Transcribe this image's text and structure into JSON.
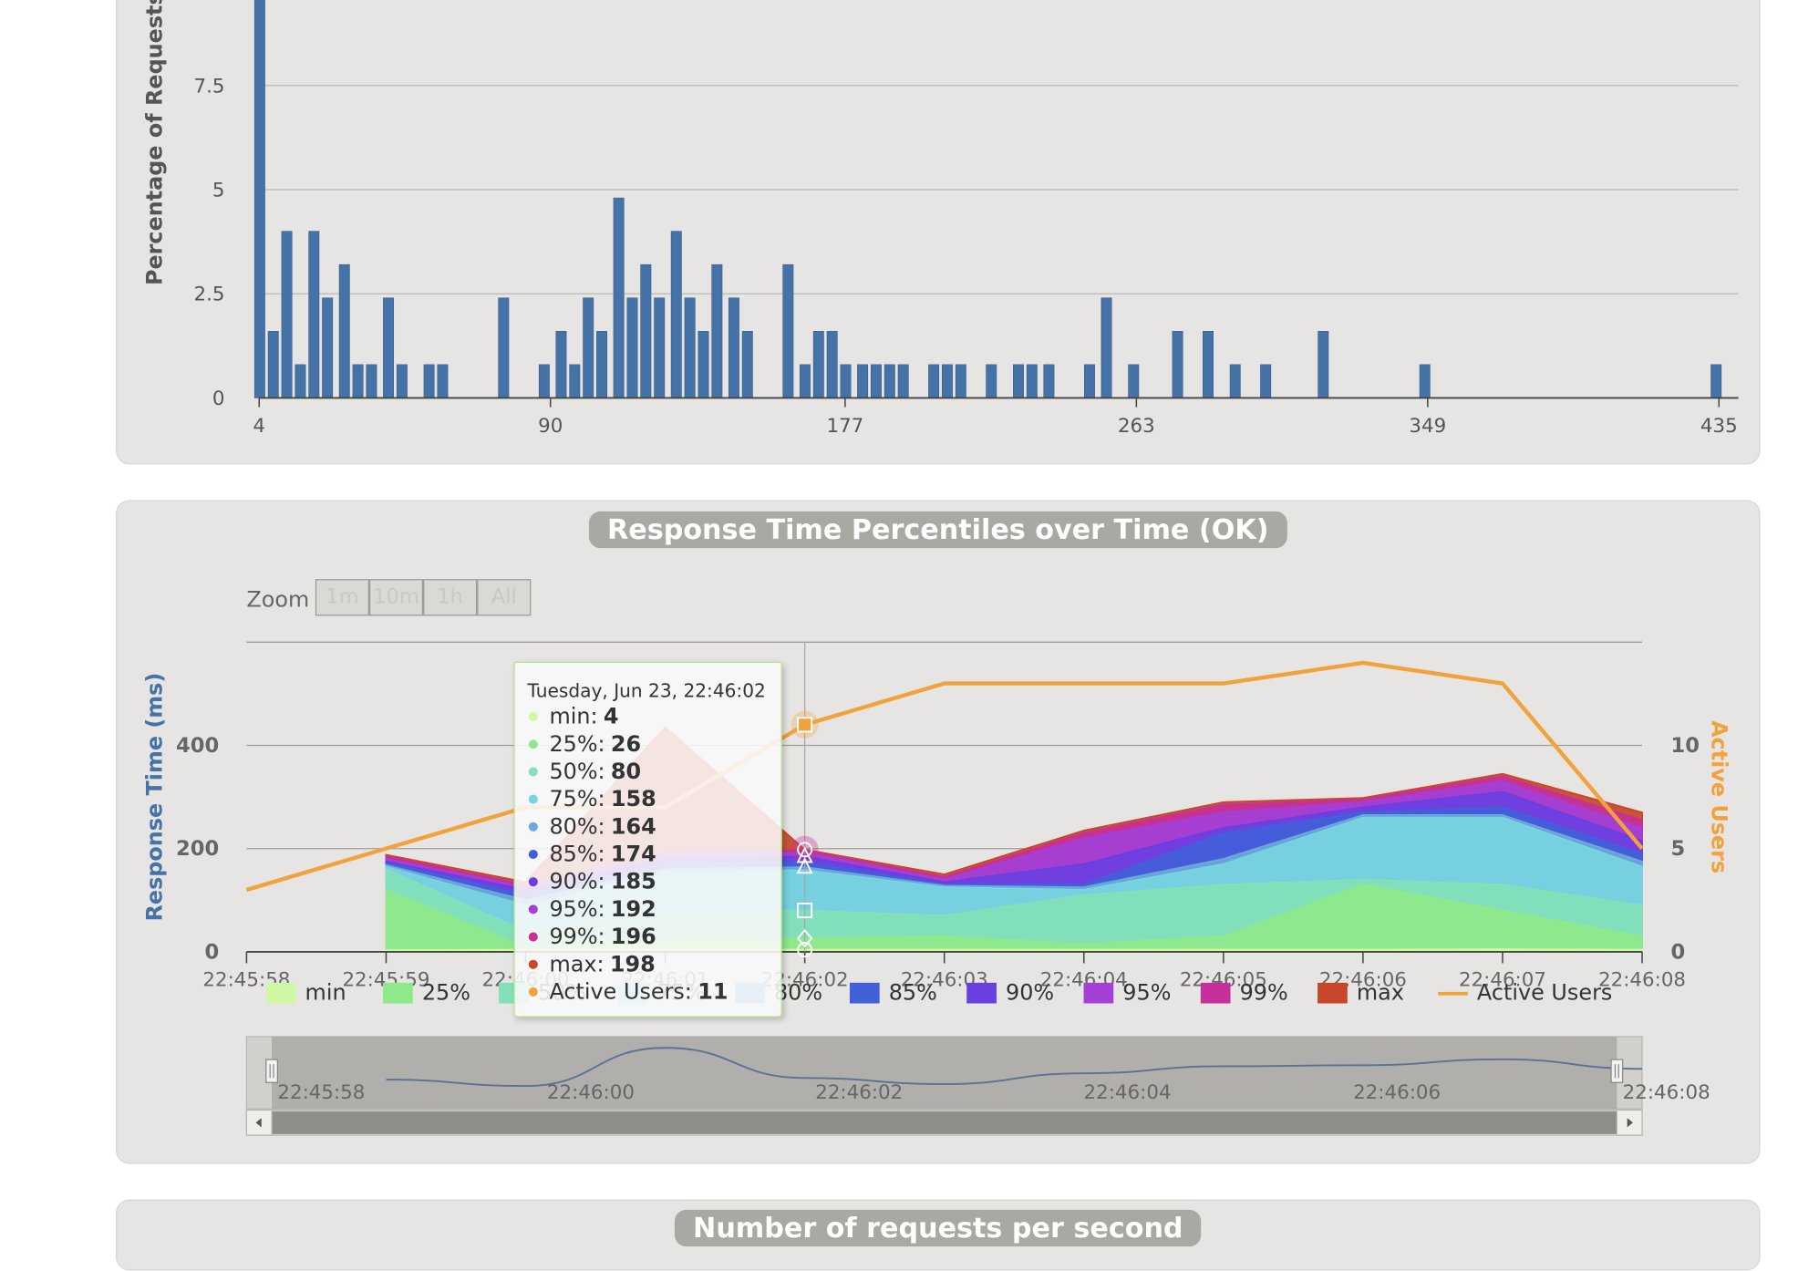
{
  "distribution": {
    "ylabel": "Percentage of Requests",
    "yticks": [
      "0",
      "2.5",
      "5",
      "7.5"
    ],
    "xticks": [
      "4",
      "90",
      "177",
      "263",
      "349",
      "435"
    ]
  },
  "percentiles": {
    "title": "Response Time Percentiles over Time (OK)",
    "zoom_label": "Zoom",
    "zoom_buttons": [
      "1m",
      "10m",
      "1h",
      "All"
    ],
    "left_axis_label": "Response Time (ms)",
    "right_axis_label": "Active Users",
    "left_ticks": [
      "0",
      "200",
      "400"
    ],
    "right_ticks": [
      "0",
      "5",
      "10"
    ],
    "x_ticks": [
      "22:45:58",
      "22:45:59",
      "22:46:00",
      "22:46:01",
      "22:46:02",
      "22:46:03",
      "22:46:04",
      "22:46:05",
      "22:46:06",
      "22:46:07",
      "22:46:08"
    ],
    "legend": [
      "min",
      "25%",
      "50%",
      "75%",
      "80%",
      "85%",
      "90%",
      "95%",
      "99%",
      "max",
      "Active Users"
    ],
    "navigator_labels": [
      "22:45:58",
      "22:46:00",
      "22:46:02",
      "22:46:04",
      "22:46:06",
      "22:46:08"
    ],
    "tooltip": {
      "header": "Tuesday, Jun 23, 22:46:02",
      "rows": [
        {
          "label": "min:",
          "value": "4"
        },
        {
          "label": "25%:",
          "value": "26"
        },
        {
          "label": "50%:",
          "value": "80"
        },
        {
          "label": "75%:",
          "value": "158"
        },
        {
          "label": "80%:",
          "value": "164"
        },
        {
          "label": "85%:",
          "value": "174"
        },
        {
          "label": "90%:",
          "value": "185"
        },
        {
          "label": "95%:",
          "value": "192"
        },
        {
          "label": "99%:",
          "value": "196"
        },
        {
          "label": "max:",
          "value": "198"
        },
        {
          "label": "Active Users:",
          "value": "11"
        }
      ]
    }
  },
  "next_panel": {
    "title": "Number of requests per second"
  },
  "colors": {
    "min": "#d0f7a3",
    "p25": "#8fe98a",
    "p50": "#83e0b8",
    "p75": "#77d4e0",
    "p80": "#6ca8d9",
    "p85": "#4160d9",
    "p90": "#6a3fe0",
    "p95": "#a43fd8",
    "p99": "#c5309a",
    "max": "#c8472a",
    "active_users": "#f0a23c",
    "axis_blue": "#4572a7"
  },
  "chart_data": [
    {
      "type": "bar",
      "ylabel": "Percentage of Requests",
      "ylim": [
        0,
        9.8
      ],
      "xlim": [
        4,
        435
      ],
      "grid": true,
      "bars": [
        [
          4,
          9.8
        ],
        [
          8,
          1.6
        ],
        [
          12,
          4.0
        ],
        [
          16,
          0.8
        ],
        [
          20,
          4.0
        ],
        [
          24,
          2.4
        ],
        [
          29,
          3.2
        ],
        [
          33,
          0.8
        ],
        [
          37,
          0.8
        ],
        [
          42,
          2.4
        ],
        [
          46,
          0.8
        ],
        [
          54,
          0.8
        ],
        [
          58,
          0.8
        ],
        [
          76,
          2.4
        ],
        [
          88,
          0.8
        ],
        [
          93,
          1.6
        ],
        [
          97,
          0.8
        ],
        [
          101,
          2.4
        ],
        [
          105,
          1.6
        ],
        [
          110,
          4.8
        ],
        [
          114,
          2.4
        ],
        [
          118,
          3.2
        ],
        [
          122,
          2.4
        ],
        [
          127,
          4.0
        ],
        [
          131,
          2.4
        ],
        [
          135,
          1.6
        ],
        [
          139,
          3.2
        ],
        [
          144,
          2.4
        ],
        [
          148,
          1.6
        ],
        [
          160,
          3.2
        ],
        [
          165,
          0.8
        ],
        [
          169,
          1.6
        ],
        [
          173,
          1.6
        ],
        [
          177,
          0.8
        ],
        [
          182,
          0.8
        ],
        [
          186,
          0.8
        ],
        [
          190,
          0.8
        ],
        [
          194,
          0.8
        ],
        [
          203,
          0.8
        ],
        [
          207,
          0.8
        ],
        [
          211,
          0.8
        ],
        [
          220,
          0.8
        ],
        [
          228,
          0.8
        ],
        [
          232,
          0.8
        ],
        [
          237,
          0.8
        ],
        [
          249,
          0.8
        ],
        [
          254,
          2.4
        ],
        [
          262,
          0.8
        ],
        [
          275,
          1.6
        ],
        [
          284,
          1.6
        ],
        [
          292,
          0.8
        ],
        [
          301,
          0.8
        ],
        [
          318,
          1.6
        ],
        [
          348,
          0.8
        ],
        [
          434,
          0.8
        ]
      ]
    },
    {
      "type": "area",
      "title": "Response Time Percentiles over Time (OK)",
      "x": [
        "22:45:58",
        "22:45:59",
        "22:46:00",
        "22:46:01",
        "22:46:02",
        "22:46:03",
        "22:46:04",
        "22:46:05",
        "22:46:06",
        "22:46:07",
        "22:46:08"
      ],
      "x_seconds": [
        0,
        1,
        2,
        3,
        4,
        5,
        6,
        7,
        8,
        9,
        10
      ],
      "left_ylim": [
        0,
        600
      ],
      "right_ylim": [
        0,
        15
      ],
      "series": [
        {
          "name": "min",
          "x": [
            1,
            2,
            3,
            4,
            5,
            6,
            7,
            8,
            9,
            10
          ],
          "values": [
            3,
            4,
            5,
            4,
            4,
            4,
            4,
            4,
            5,
            4
          ]
        },
        {
          "name": "25%",
          "x": [
            1,
            2,
            3,
            4,
            5,
            6,
            7,
            8,
            9,
            10
          ],
          "values": [
            120,
            10,
            26,
            26,
            30,
            15,
            30,
            130,
            80,
            30
          ]
        },
        {
          "name": "50%",
          "x": [
            1,
            2,
            3,
            4,
            5,
            6,
            7,
            8,
            9,
            10
          ],
          "values": [
            160,
            40,
            80,
            80,
            70,
            110,
            130,
            140,
            130,
            90
          ]
        },
        {
          "name": "75%",
          "x": [
            1,
            2,
            3,
            4,
            5,
            6,
            7,
            8,
            9,
            10
          ],
          "values": [
            165,
            90,
            155,
            158,
            125,
            120,
            170,
            260,
            260,
            165
          ]
        },
        {
          "name": "80%",
          "x": [
            1,
            2,
            3,
            4,
            5,
            6,
            7,
            8,
            9,
            10
          ],
          "values": [
            168,
            100,
            160,
            164,
            128,
            125,
            180,
            265,
            265,
            175
          ]
        },
        {
          "name": "85%",
          "x": [
            1,
            2,
            3,
            4,
            5,
            6,
            7,
            8,
            9,
            10
          ],
          "values": [
            172,
            110,
            170,
            174,
            130,
            130,
            230,
            270,
            280,
            190
          ]
        },
        {
          "name": "90%",
          "x": [
            1,
            2,
            3,
            4,
            5,
            6,
            7,
            8,
            9,
            10
          ],
          "values": [
            175,
            120,
            180,
            185,
            135,
            170,
            240,
            280,
            310,
            215
          ]
        },
        {
          "name": "95%",
          "x": [
            1,
            2,
            3,
            4,
            5,
            6,
            7,
            8,
            9,
            10
          ],
          "values": [
            180,
            125,
            188,
            192,
            140,
            220,
            270,
            290,
            330,
            240
          ]
        },
        {
          "name": "99%",
          "x": [
            1,
            2,
            3,
            4,
            5,
            6,
            7,
            8,
            9,
            10
          ],
          "values": [
            185,
            130,
            192,
            196,
            145,
            230,
            285,
            295,
            340,
            255
          ]
        },
        {
          "name": "max",
          "x": [
            1,
            2,
            3,
            4,
            5,
            6,
            7,
            8,
            9,
            10
          ],
          "values": [
            188,
            135,
            435,
            198,
            150,
            235,
            290,
            298,
            345,
            270
          ]
        },
        {
          "name": "Active Users",
          "x": [
            0,
            1,
            2,
            3,
            4,
            5,
            6,
            7,
            8,
            9,
            10
          ],
          "values": [
            3,
            5,
            7,
            7,
            11,
            13,
            13,
            13,
            14,
            13,
            5
          ],
          "axis": "right"
        }
      ]
    }
  ]
}
